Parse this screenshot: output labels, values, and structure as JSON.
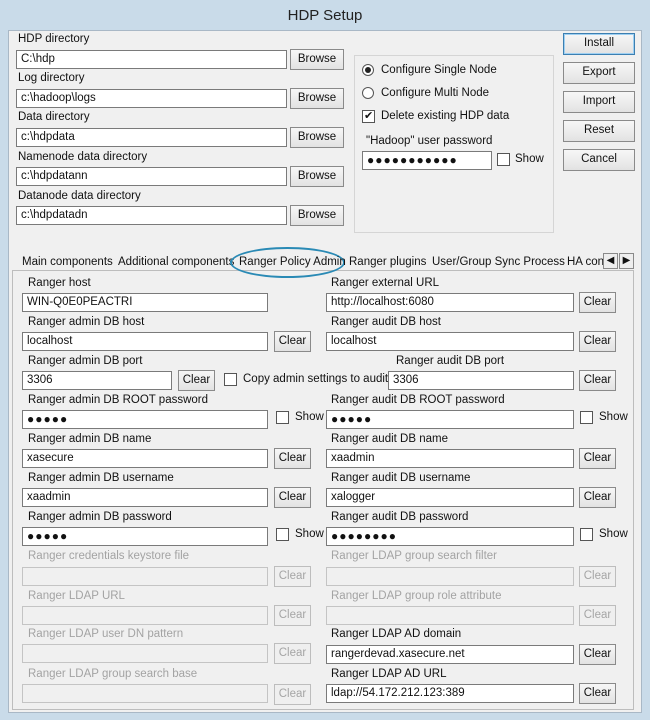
{
  "window": {
    "title": "HDP Setup"
  },
  "dirs": {
    "browse_label": "Browse",
    "items": [
      {
        "label": "HDP directory",
        "value": "C:\\hdp"
      },
      {
        "label": "Log directory",
        "value": "c:\\hadoop\\logs"
      },
      {
        "label": "Data directory",
        "value": "c:\\hdpdata"
      },
      {
        "label": "Namenode data directory",
        "value": "c:\\hdpdatann"
      },
      {
        "label": "Datanode data directory",
        "value": "c:\\hdpdatadn"
      }
    ]
  },
  "config": {
    "single_node_label": "Configure Single Node",
    "single_node_selected": true,
    "multi_node_label": "Configure Multi Node",
    "delete_existing_label": "Delete existing HDP data",
    "delete_existing_checked": true,
    "hadoop_pw_label": "\"Hadoop\" user password",
    "hadoop_pw_value": "●●●●●●●●●●●",
    "show_label": "Show"
  },
  "actions": {
    "install": "Install",
    "export": "Export",
    "import": "Import",
    "reset": "Reset",
    "cancel": "Cancel"
  },
  "tabs": {
    "main": "Main components",
    "additional": "Additional components",
    "ranger_policy": "Ranger Policy Admin",
    "ranger_plugins": "Ranger plugins",
    "usersync": "User/Group Sync Process",
    "ha": "HA con",
    "scroll_left": "◀",
    "scroll_right": "▶"
  },
  "ranger": {
    "clear": "Clear",
    "show": "Show",
    "host_label": "Ranger host",
    "host_value": "WIN-Q0E0PEACTRI",
    "external_url_label": "Ranger external URL",
    "external_url_value": "http://localhost:6080",
    "admin_db_host_label": "Ranger admin DB host",
    "admin_db_host_value": "localhost",
    "audit_db_host_label": "Ranger audit DB host",
    "audit_db_host_value": "localhost",
    "admin_db_port_label": "Ranger admin DB port",
    "admin_db_port_value": "3306",
    "copy_admin_label": "Copy admin settings to audit",
    "audit_db_port_label": "Ranger audit DB port",
    "audit_db_port_value": "3306",
    "admin_root_pw_label": "Ranger admin DB ROOT password",
    "admin_root_pw_value": "●●●●●",
    "audit_root_pw_label": "Ranger audit DB ROOT password",
    "audit_root_pw_value": "●●●●●",
    "admin_db_name_label": "Ranger admin DB name",
    "admin_db_name_value": "xasecure",
    "audit_db_name_label": "Ranger audit DB name",
    "audit_db_name_value": "xaadmin",
    "admin_db_user_label": "Ranger admin DB username",
    "admin_db_user_value": "xaadmin",
    "audit_db_user_label": "Ranger audit DB username",
    "audit_db_user_value": "xalogger",
    "admin_db_pw_label": "Ranger admin DB password",
    "admin_db_pw_value": "●●●●●",
    "audit_db_pw_label": "Ranger audit DB password",
    "audit_db_pw_value": "●●●●●●●●",
    "keystore_label": "Ranger credentials keystore file",
    "ldap_group_filter_label": "Ranger LDAP group search filter",
    "ldap_url_label": "Ranger LDAP URL",
    "ldap_group_role_label": "Ranger LDAP group role attribute",
    "ldap_user_dn_label": "Ranger LDAP user DN pattern",
    "ldap_ad_domain_label": "Ranger LDAP AD domain",
    "ldap_ad_domain_value": "rangerdevad.xasecure.net",
    "ldap_group_base_label": "Ranger LDAP group search base",
    "ldap_ad_url_label": "Ranger LDAP AD URL",
    "ldap_ad_url_value": "ldap://54.172.212.123:389"
  }
}
